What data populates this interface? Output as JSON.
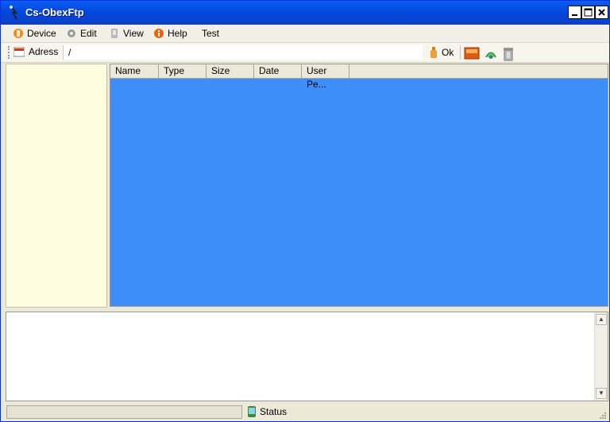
{
  "window": {
    "title": "Cs-ObexFtp"
  },
  "menu": {
    "device": "Device",
    "edit": "Edit",
    "view": "View",
    "help": "Help",
    "test": "Test"
  },
  "toolbar": {
    "address_label": "Adress",
    "address_value": "/",
    "ok_label": "Ok"
  },
  "file_list": {
    "columns": [
      "Name",
      "Type",
      "Size",
      "Date",
      "User Pe..."
    ],
    "rows": []
  },
  "output": {
    "text": ""
  },
  "statusbar": {
    "status_label": "Status"
  },
  "icons": {
    "device": "device-icon",
    "edit": "gear-icon",
    "view": "view-icon",
    "help": "info-icon",
    "address": "address-icon",
    "ok": "ok-icon",
    "connect": "connect-icon",
    "signal": "signal-icon",
    "trash": "trash-icon",
    "status": "status-icon"
  },
  "colors": {
    "titlebar": "#0348dd",
    "list_background": "#3d8ef8",
    "tree_background": "#fffde0"
  }
}
